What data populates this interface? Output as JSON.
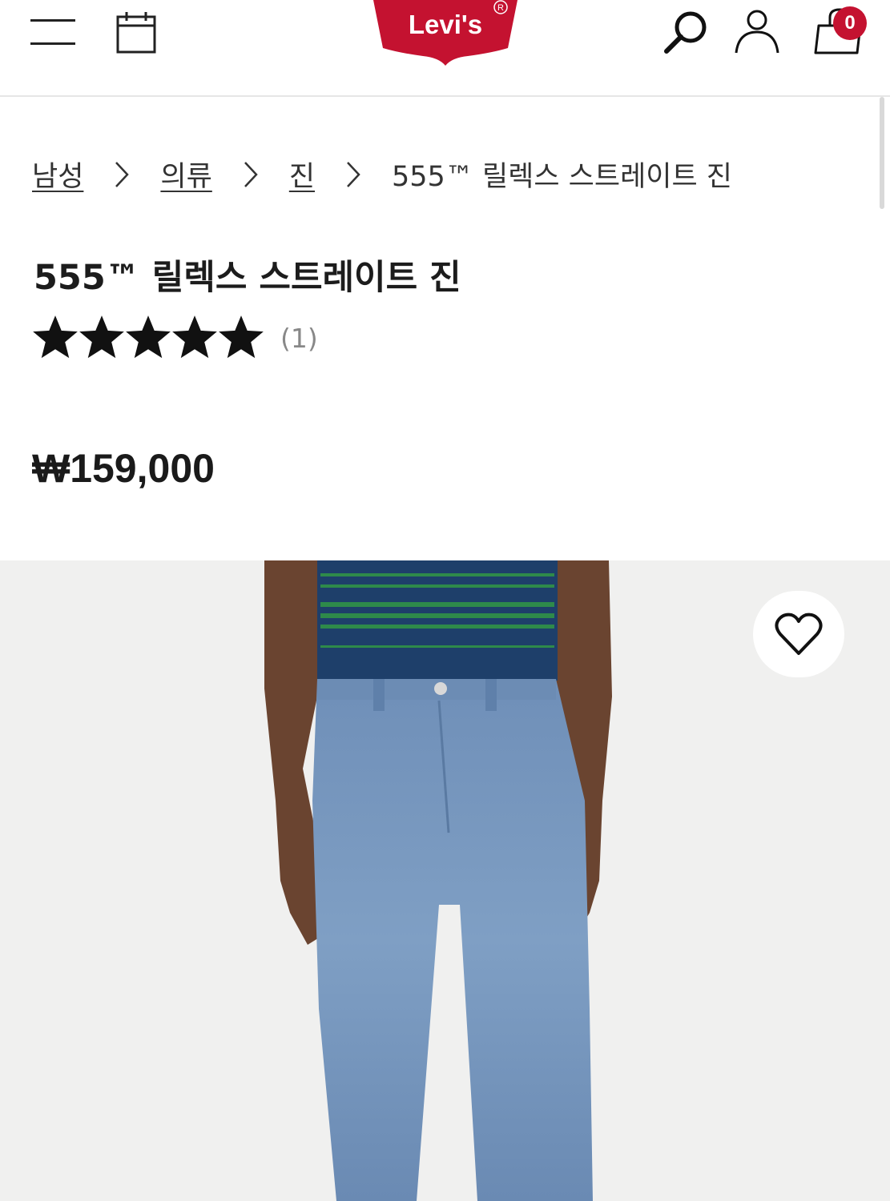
{
  "header": {
    "logo_text": "Levi's",
    "bag_count": "0",
    "icons": [
      "menu-icon",
      "calendar-icon",
      "search-icon",
      "account-icon",
      "shopping-bag-icon"
    ],
    "brand_color": "#c41230"
  },
  "breadcrumb": {
    "items": [
      {
        "label": "남성"
      },
      {
        "label": "의류"
      },
      {
        "label": "진"
      }
    ],
    "current": "555™ 릴렉스 스트레이트 진"
  },
  "product": {
    "title": "555™ 릴렉스 스트레이트 진",
    "rating": 5,
    "review_count": "(1)",
    "price": "₩159,000"
  },
  "image": {
    "wishlist_icon": "heart-icon"
  }
}
